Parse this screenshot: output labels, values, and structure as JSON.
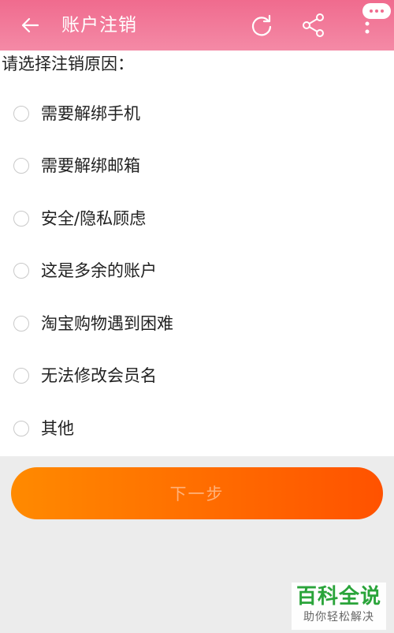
{
  "header": {
    "title": "账户注销"
  },
  "form": {
    "prompt": "请选择注销原因：",
    "options": [
      {
        "label": "需要解绑手机",
        "selected": false
      },
      {
        "label": "需要解绑邮箱",
        "selected": false
      },
      {
        "label": "安全/隐私顾虑",
        "selected": false
      },
      {
        "label": "这是多余的账户",
        "selected": false
      },
      {
        "label": "淘宝购物遇到困难",
        "selected": false
      },
      {
        "label": "无法修改会员名",
        "selected": false
      },
      {
        "label": "其他",
        "selected": false
      }
    ],
    "next_label": "下一步"
  },
  "watermark": {
    "main": "百科全说",
    "sub": "助你轻松解决"
  },
  "icons": {
    "back": "arrow-left-icon",
    "refresh": "refresh-icon",
    "share": "share-icon",
    "more": "more-vertical-icon"
  },
  "colors": {
    "header": "#f48aa6",
    "button_start": "#ff8a00",
    "button_end": "#ff5200",
    "watermark_green": "#2aa43a"
  }
}
